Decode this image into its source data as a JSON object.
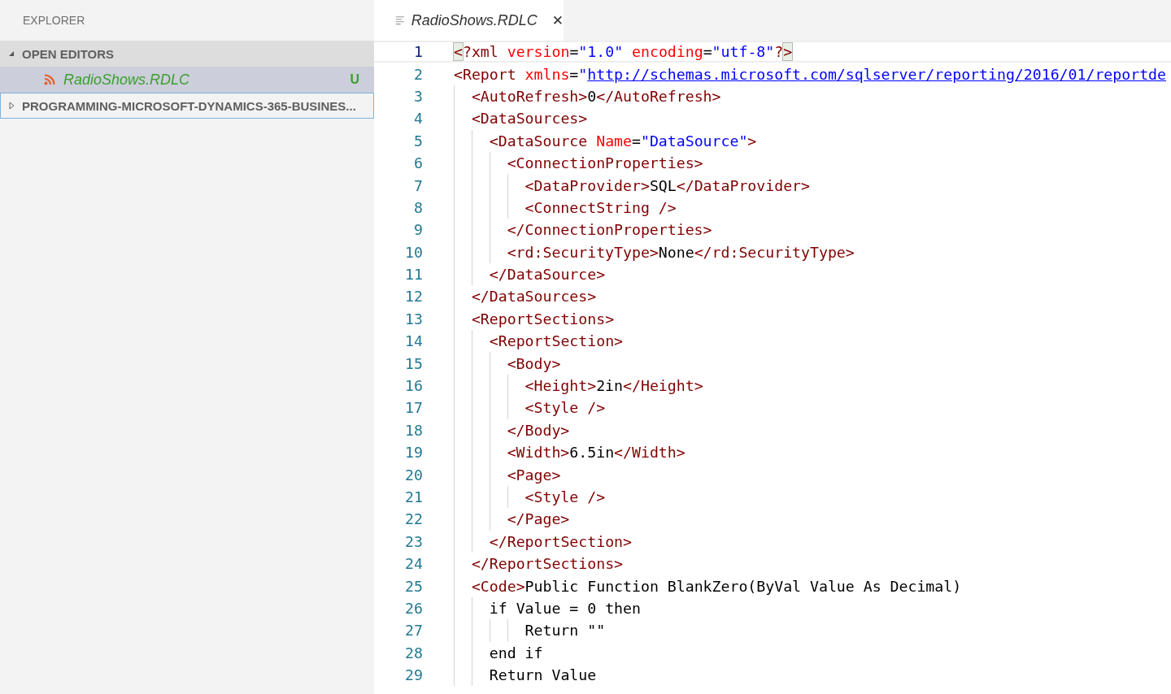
{
  "sidebar": {
    "title": "EXPLORER",
    "sections": [
      {
        "label": "OPEN EDITORS",
        "expanded": true,
        "focused": false,
        "items": [
          {
            "name": "RadioShows.RDLC",
            "badge": "U",
            "selected": true
          }
        ]
      },
      {
        "label": "PROGRAMMING-MICROSOFT-DYNAMICS-365-BUSINES...",
        "expanded": false,
        "focused": true
      }
    ]
  },
  "tabs": [
    {
      "label": "RadioShows.RDLC",
      "selected": true,
      "close": "✕"
    }
  ],
  "editor": {
    "lines": [
      {
        "number": "1",
        "current": true,
        "tokens": [
          {
            "kind": "match",
            "text": "<"
          },
          {
            "kind": "tag",
            "text": "?xml"
          },
          {
            "kind": "attr",
            "text": " version"
          },
          {
            "kind": "text",
            "text": "="
          },
          {
            "kind": "value",
            "text": "\"1.0\""
          },
          {
            "kind": "attr",
            "text": " encoding"
          },
          {
            "kind": "text",
            "text": "="
          },
          {
            "kind": "value",
            "text": "\"utf-8\""
          },
          {
            "kind": "tag",
            "text": "?"
          },
          {
            "kind": "match",
            "text": ">"
          }
        ]
      },
      {
        "number": "2",
        "current": false,
        "tokens": [
          {
            "kind": "tag",
            "text": "<Report"
          },
          {
            "kind": "attr",
            "text": " xmlns"
          },
          {
            "kind": "text",
            "text": "="
          },
          {
            "kind": "value",
            "text": "\""
          },
          {
            "kind": "link",
            "text": "http://schemas.microsoft.com/sqlserver/reporting/2016/01/reportde"
          }
        ]
      },
      {
        "number": "3",
        "current": false,
        "tokens": [
          {
            "kind": "tag",
            "text": "  <AutoRefresh>"
          },
          {
            "kind": "text",
            "text": "0"
          },
          {
            "kind": "tag",
            "text": "</AutoRefresh>"
          }
        ]
      },
      {
        "number": "4",
        "current": false,
        "tokens": [
          {
            "kind": "tag",
            "text": "  <DataSources>"
          }
        ]
      },
      {
        "number": "5",
        "current": false,
        "tokens": [
          {
            "kind": "tag",
            "text": "    <DataSource"
          },
          {
            "kind": "attr",
            "text": " Name"
          },
          {
            "kind": "text",
            "text": "="
          },
          {
            "kind": "value",
            "text": "\"DataSource\""
          },
          {
            "kind": "tag",
            "text": ">"
          }
        ]
      },
      {
        "number": "6",
        "current": false,
        "tokens": [
          {
            "kind": "tag",
            "text": "      <ConnectionProperties>"
          }
        ]
      },
      {
        "number": "7",
        "current": false,
        "tokens": [
          {
            "kind": "tag",
            "text": "        <DataProvider>"
          },
          {
            "kind": "text",
            "text": "SQL"
          },
          {
            "kind": "tag",
            "text": "</DataProvider>"
          }
        ]
      },
      {
        "number": "8",
        "current": false,
        "tokens": [
          {
            "kind": "tag",
            "text": "        <ConnectString />"
          }
        ]
      },
      {
        "number": "9",
        "current": false,
        "tokens": [
          {
            "kind": "tag",
            "text": "      </ConnectionProperties>"
          }
        ]
      },
      {
        "number": "10",
        "current": false,
        "tokens": [
          {
            "kind": "tag",
            "text": "      <rd:SecurityType>"
          },
          {
            "kind": "text",
            "text": "None"
          },
          {
            "kind": "tag",
            "text": "</rd:SecurityType>"
          }
        ]
      },
      {
        "number": "11",
        "current": false,
        "tokens": [
          {
            "kind": "tag",
            "text": "    </DataSource>"
          }
        ]
      },
      {
        "number": "12",
        "current": false,
        "tokens": [
          {
            "kind": "tag",
            "text": "  </DataSources>"
          }
        ]
      },
      {
        "number": "13",
        "current": false,
        "tokens": [
          {
            "kind": "tag",
            "text": "  <ReportSections>"
          }
        ]
      },
      {
        "number": "14",
        "current": false,
        "tokens": [
          {
            "kind": "tag",
            "text": "    <ReportSection>"
          }
        ]
      },
      {
        "number": "15",
        "current": false,
        "tokens": [
          {
            "kind": "tag",
            "text": "      <Body>"
          }
        ]
      },
      {
        "number": "16",
        "current": false,
        "tokens": [
          {
            "kind": "tag",
            "text": "        <Height>"
          },
          {
            "kind": "text",
            "text": "2in"
          },
          {
            "kind": "tag",
            "text": "</Height>"
          }
        ]
      },
      {
        "number": "17",
        "current": false,
        "tokens": [
          {
            "kind": "tag",
            "text": "        <Style />"
          }
        ]
      },
      {
        "number": "18",
        "current": false,
        "tokens": [
          {
            "kind": "tag",
            "text": "      </Body>"
          }
        ]
      },
      {
        "number": "19",
        "current": false,
        "tokens": [
          {
            "kind": "tag",
            "text": "      <Width>"
          },
          {
            "kind": "text",
            "text": "6.5in"
          },
          {
            "kind": "tag",
            "text": "</Width>"
          }
        ]
      },
      {
        "number": "20",
        "current": false,
        "tokens": [
          {
            "kind": "tag",
            "text": "      <Page>"
          }
        ]
      },
      {
        "number": "21",
        "current": false,
        "tokens": [
          {
            "kind": "tag",
            "text": "        <Style />"
          }
        ]
      },
      {
        "number": "22",
        "current": false,
        "tokens": [
          {
            "kind": "tag",
            "text": "      </Page>"
          }
        ]
      },
      {
        "number": "23",
        "current": false,
        "tokens": [
          {
            "kind": "tag",
            "text": "    </ReportSection>"
          }
        ]
      },
      {
        "number": "24",
        "current": false,
        "tokens": [
          {
            "kind": "tag",
            "text": "  </ReportSections>"
          }
        ]
      },
      {
        "number": "25",
        "current": false,
        "tokens": [
          {
            "kind": "tag",
            "text": "  <Code>"
          },
          {
            "kind": "text",
            "text": "Public Function BlankZero(ByVal Value As Decimal)"
          }
        ]
      },
      {
        "number": "26",
        "current": false,
        "tokens": [
          {
            "kind": "text",
            "text": "    if Value = 0 then"
          }
        ]
      },
      {
        "number": "27",
        "current": false,
        "tokens": [
          {
            "kind": "text",
            "text": "        Return \"\""
          }
        ]
      },
      {
        "number": "28",
        "current": false,
        "tokens": [
          {
            "kind": "text",
            "text": "    end if"
          }
        ]
      },
      {
        "number": "29",
        "current": false,
        "tokens": [
          {
            "kind": "text",
            "text": "    Return Value"
          }
        ]
      }
    ]
  }
}
